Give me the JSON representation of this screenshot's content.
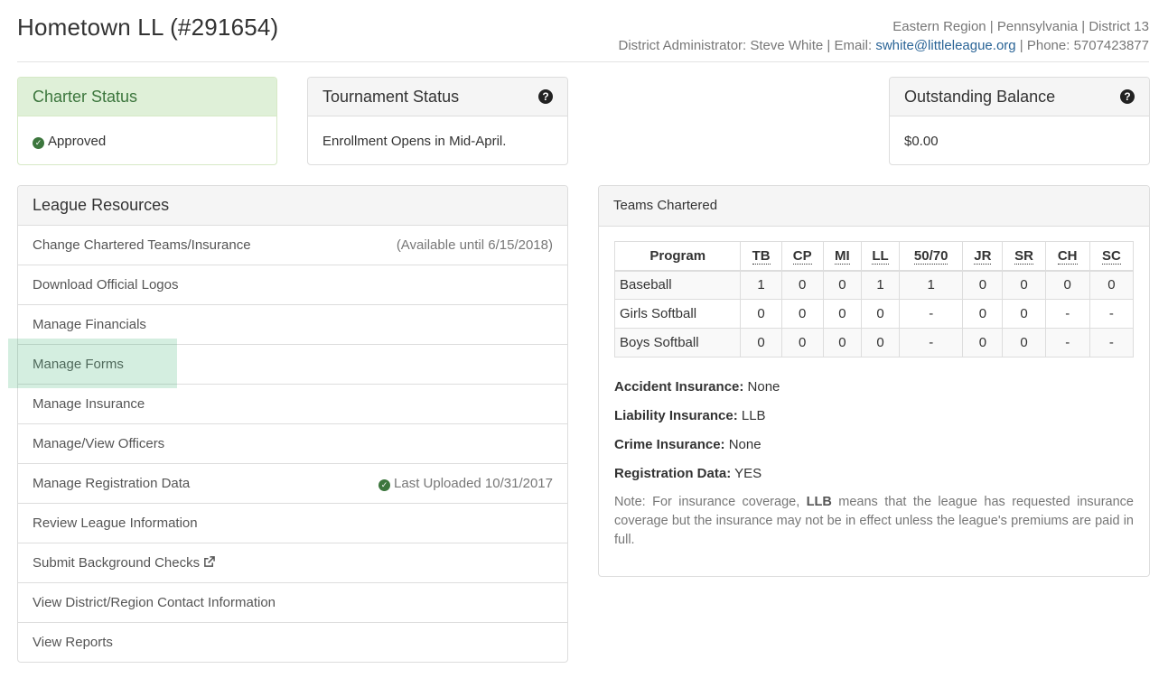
{
  "header": {
    "title": "Hometown LL (#291654)",
    "region_line": "Eastern Region | Pennsylvania | District 13",
    "admin_prefix": "District Administrator: Steve White | Email: ",
    "admin_email": "swhite@littleleague.org",
    "admin_phone": " | Phone: 5707423877"
  },
  "charter": {
    "title": "Charter Status",
    "status": "Approved"
  },
  "tournament": {
    "title": "Tournament Status",
    "status": "Enrollment Opens in Mid-April."
  },
  "balance": {
    "title": "Outstanding Balance",
    "amount": "$0.00"
  },
  "resources": {
    "title": "League Resources",
    "items": [
      {
        "label": "Change Chartered Teams/Insurance",
        "right": "(Available until 6/15/2018)"
      },
      {
        "label": "Download Official Logos"
      },
      {
        "label": "Manage Financials"
      },
      {
        "label": "Manage Forms"
      },
      {
        "label": "Manage Insurance"
      },
      {
        "label": "Manage/View Officers"
      },
      {
        "label": "Manage Registration Data",
        "right": "Last Uploaded 10/31/2017"
      },
      {
        "label": "Review League Information"
      },
      {
        "label": "Submit Background Checks"
      },
      {
        "label": "View District/Region Contact Information"
      },
      {
        "label": "View Reports"
      }
    ]
  },
  "teams": {
    "title": "Teams Chartered",
    "columns": [
      "Program",
      "TB",
      "CP",
      "MI",
      "LL",
      "50/70",
      "JR",
      "SR",
      "CH",
      "SC"
    ],
    "rows": [
      [
        "Baseball",
        "1",
        "0",
        "0",
        "1",
        "1",
        "0",
        "0",
        "0",
        "0"
      ],
      [
        "Girls Softball",
        "0",
        "0",
        "0",
        "0",
        "-",
        "0",
        "0",
        "-",
        "-"
      ],
      [
        "Boys Softball",
        "0",
        "0",
        "0",
        "0",
        "-",
        "0",
        "0",
        "-",
        "-"
      ]
    ],
    "accident_label": "Accident Insurance:",
    "accident_value": " None",
    "liability_label": "Liability Insurance:",
    "liability_value": " LLB",
    "crime_label": "Crime Insurance:",
    "crime_value": " None",
    "registration_label": "Registration Data:",
    "registration_value": " YES",
    "note_prefix": "Note: For insurance coverage, ",
    "note_bold": "LLB",
    "note_suffix": " means that the league has requested insurance coverage but the insurance may not be in effect unless the league's premiums are paid in full."
  }
}
